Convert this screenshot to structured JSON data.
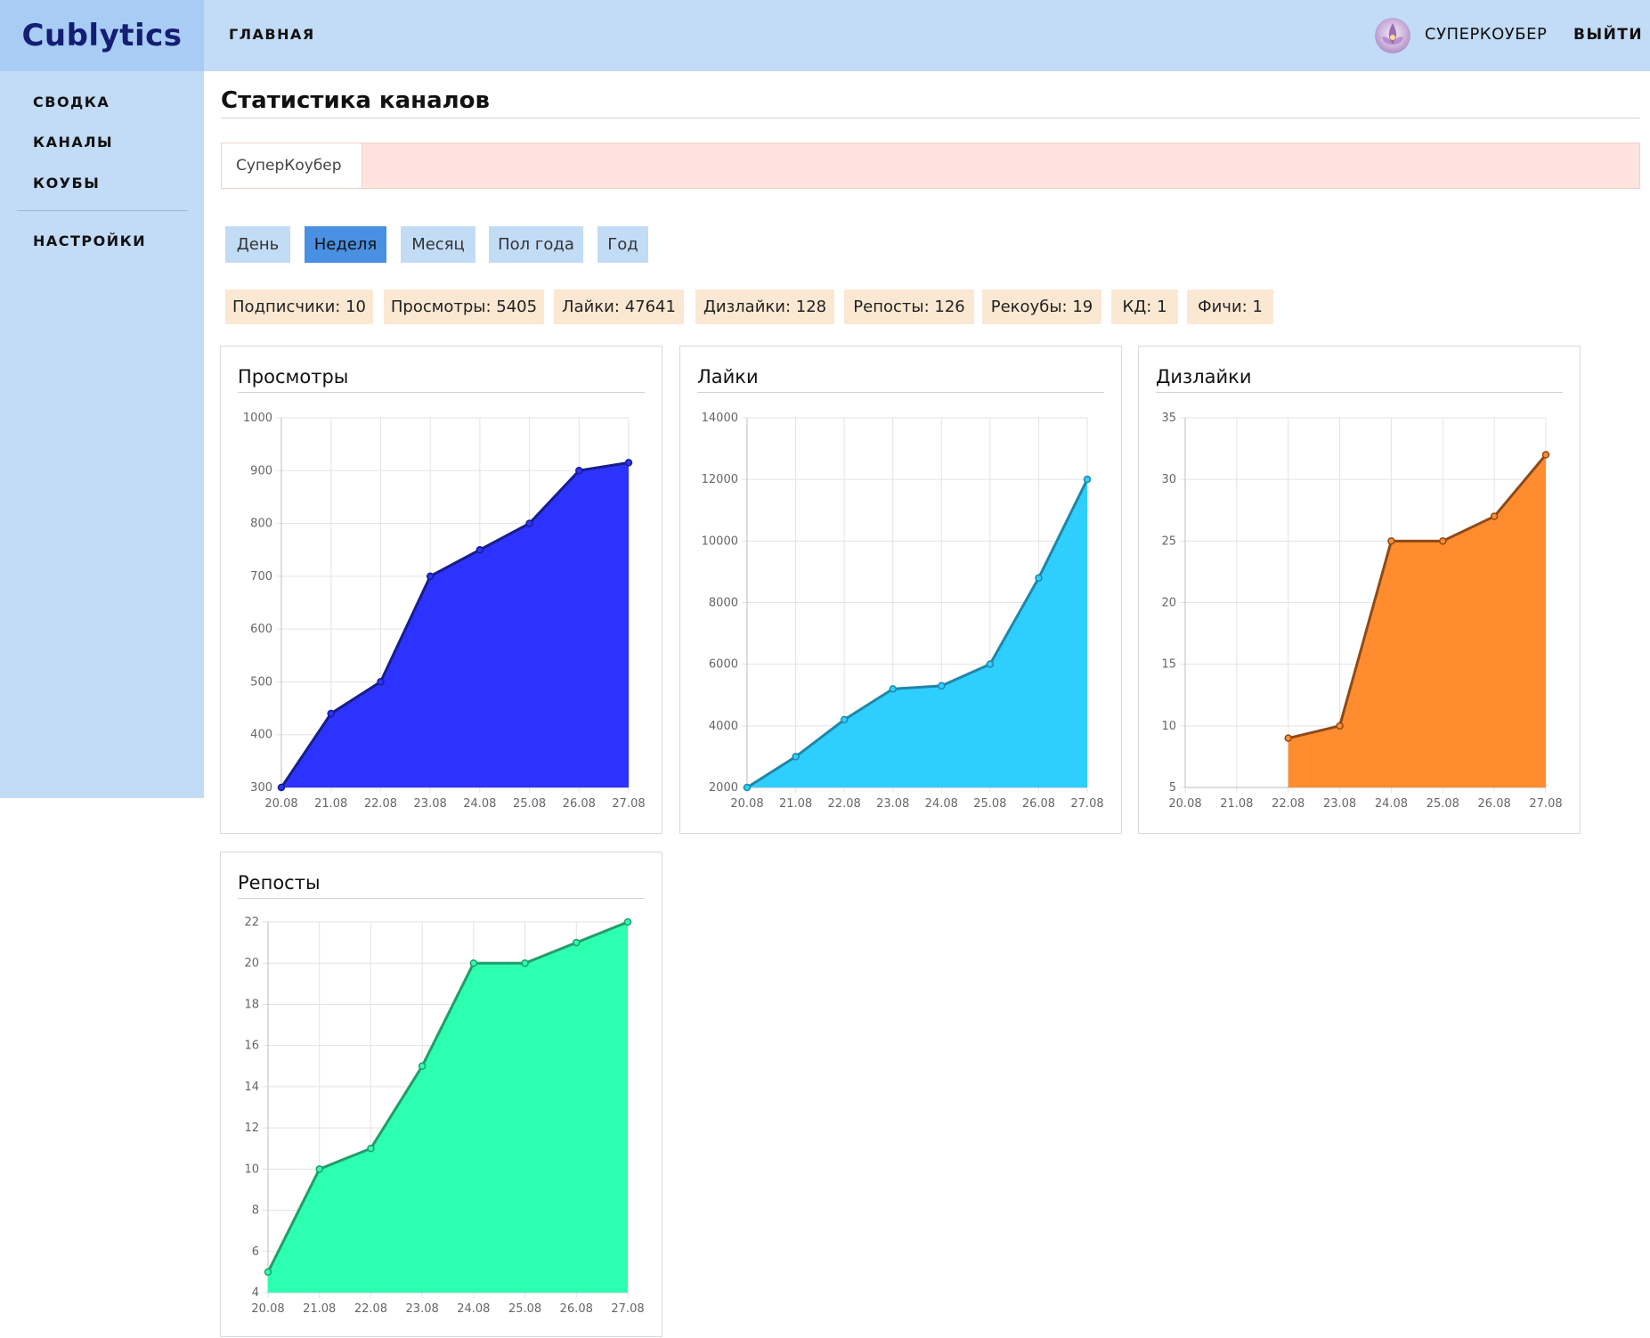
{
  "brand": "Cublytics",
  "header": {
    "nav_home": "ГЛАВНАЯ",
    "username": "СУПЕРКОУБЕР",
    "logout": "ВЫЙТИ"
  },
  "sidebar": {
    "items": [
      "СВОДКА",
      "КАНАЛЫ",
      "КОУБЫ"
    ],
    "settings": "НАСТРОЙКИ"
  },
  "page_title": "Статистика каналов",
  "channel_tab": "СуперКоубер",
  "periods": {
    "items": [
      "День",
      "Неделя",
      "Месяц",
      "Пол года",
      "Год"
    ],
    "active": "Неделя"
  },
  "stats": [
    {
      "label": "Подписчики:",
      "value": "10"
    },
    {
      "label": "Просмотры:",
      "value": "5405"
    },
    {
      "label": "Лайки:",
      "value": "47641"
    },
    {
      "label": "Дизлайки:",
      "value": "128"
    },
    {
      "label": "Репосты:",
      "value": "126"
    },
    {
      "label": "Рекоубы:",
      "value": "19"
    },
    {
      "label": "КД:",
      "value": "1"
    },
    {
      "label": "Фичи:",
      "value": "1"
    }
  ],
  "colors": {
    "views_fill": "#2d33ff",
    "views_line": "#181d8c",
    "likes_fill": "#2ecfff",
    "likes_line": "#1f87a8",
    "dislikes_fill": "#ff8c2e",
    "dislikes_line": "#8f4a18",
    "reposts_fill": "#2dffb0",
    "reposts_line": "#1f9e6a"
  },
  "chart_data": [
    {
      "type": "area",
      "title": "Просмотры",
      "x": [
        "20.08",
        "21.08",
        "22.08",
        "23.08",
        "24.08",
        "25.08",
        "26.08",
        "27.08"
      ],
      "series": [
        {
          "values": [
            300,
            440,
            500,
            700,
            750,
            800,
            900,
            915
          ]
        }
      ],
      "ylim": [
        300,
        1000
      ],
      "yticks": [
        300,
        400,
        500,
        600,
        700,
        800,
        900,
        1000
      ],
      "grid": true
    },
    {
      "type": "area",
      "title": "Лайки",
      "x": [
        "20.08",
        "21.08",
        "22.08",
        "23.08",
        "24.08",
        "25.08",
        "26.08",
        "27.08"
      ],
      "series": [
        {
          "values": [
            2000,
            3000,
            4200,
            5200,
            5300,
            6000,
            8800,
            12000
          ]
        }
      ],
      "ylim": [
        2000,
        14000
      ],
      "yticks": [
        2000,
        4000,
        6000,
        8000,
        10000,
        12000,
        14000
      ],
      "grid": true
    },
    {
      "type": "area",
      "title": "Дизлайки",
      "x": [
        "20.08",
        "21.08",
        "22.08",
        "23.08",
        "24.08",
        "25.08",
        "26.08",
        "27.08"
      ],
      "series": [
        {
          "values": [
            null,
            null,
            9,
            10,
            25,
            25,
            27,
            32
          ]
        }
      ],
      "ylim": [
        5,
        35
      ],
      "yticks": [
        5,
        10,
        15,
        20,
        25,
        30,
        35
      ],
      "grid": true
    },
    {
      "type": "area",
      "title": "Репосты",
      "x": [
        "20.08",
        "21.08",
        "22.08",
        "23.08",
        "24.08",
        "25.08",
        "26.08",
        "27.08"
      ],
      "series": [
        {
          "values": [
            5,
            10,
            11,
            15,
            20,
            20,
            21,
            22
          ]
        }
      ],
      "ylim": [
        4,
        22
      ],
      "yticks": [
        4,
        6,
        8,
        10,
        12,
        14,
        16,
        18,
        20,
        22
      ],
      "grid": true
    }
  ]
}
